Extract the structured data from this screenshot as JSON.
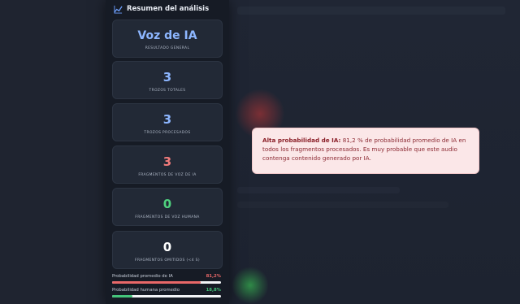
{
  "sidebar": {
    "title": "Resumen del análisis",
    "icon": "trend-chart-icon",
    "result": {
      "value": "Voz de IA",
      "label": "RESULTADO GENERAL"
    },
    "stats": [
      {
        "value": "3",
        "label": "TROZOS TOTALES",
        "color": "#8db6ff"
      },
      {
        "value": "3",
        "label": "TROZOS PROCESADOS",
        "color": "#8db6ff"
      },
      {
        "value": "3",
        "label": "FRAGMENTOS DE VOZ DE IA",
        "color": "#f07b7b"
      },
      {
        "value": "0",
        "label": "FRAGMENTOS DE VOZ HUMANA",
        "color": "#4fd17e"
      },
      {
        "value": "0",
        "label": "FRAGMENTOS OMITIDOS (<4 S)",
        "color": "#ffffff"
      }
    ],
    "metrics": [
      {
        "label": "Probabilidad promedio de IA",
        "value": "81,2%",
        "fraction": 0.812,
        "color": "#e96868"
      },
      {
        "label": "Probabilidad humana promedio",
        "value": "18,8%",
        "fraction": 0.188,
        "color": "#44c47a"
      }
    ]
  },
  "alert": {
    "title": "Alta probabilidad de IA:",
    "message": "81,2 % de probabilidad promedio de IA en todos los fragmentos procesados. Es muy probable que este audio contenga contenido generado por IA."
  },
  "colors": {
    "result_value": "#8db6ff",
    "sidebar_bg": "#161b25",
    "card_bg": "#222936",
    "alert_bg": "#fbe7e8"
  }
}
